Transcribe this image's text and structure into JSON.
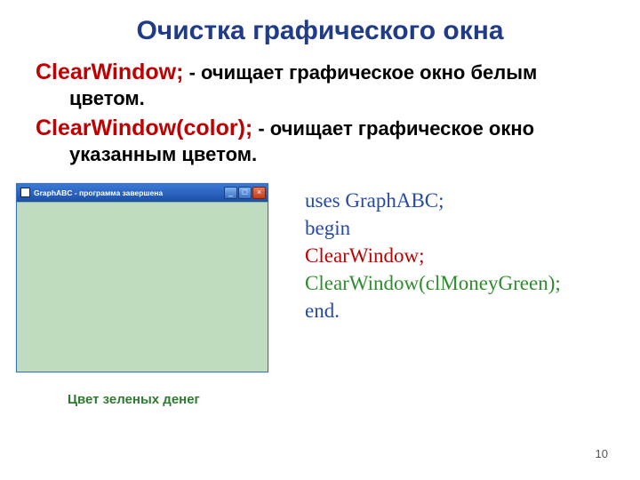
{
  "title": "Очистка графического окна",
  "lines": {
    "cmd1": "ClearWindow;",
    "cmd1_desc_a": " - очищает графическое окно белым",
    "cmd1_desc_b": "цветом.",
    "cmd2": "ClearWindow(color);",
    "cmd2_desc_a": " - очищает графическое окно",
    "cmd2_desc_b": "указанным цветом."
  },
  "window": {
    "title": "GraphABC  - программа завершена",
    "min": "_",
    "max": "□",
    "close": "×"
  },
  "caption": "Цвет зеленых денег",
  "code": {
    "l1": "uses GraphABC;",
    "l2": "begin",
    "l3": "ClearWindow;",
    "l4": "ClearWindow(clMoneyGreen);",
    "l5": "end."
  },
  "page": "10"
}
